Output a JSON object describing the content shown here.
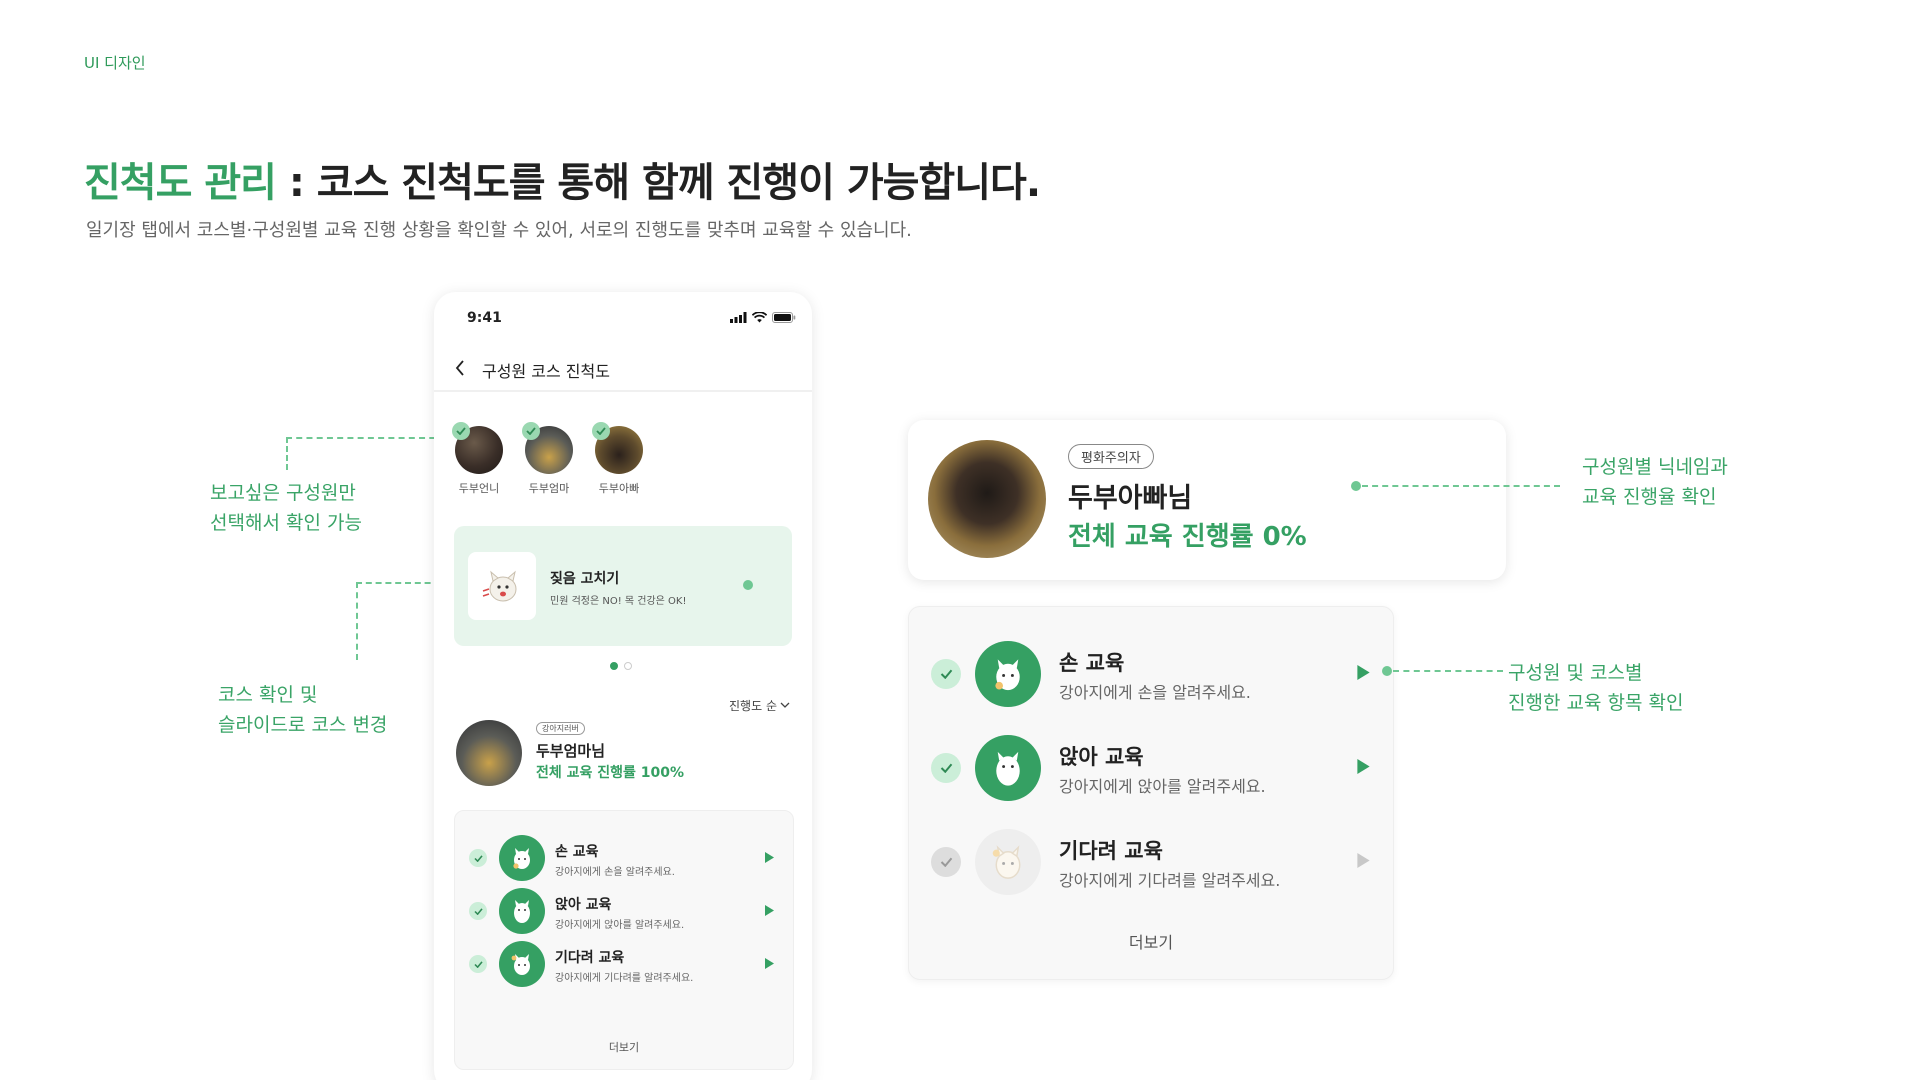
{
  "header": {
    "section_tag": "UI 디자인",
    "title_accent": "진척도 관리",
    "title_rest": " : 코스 진척도를 통해 함께 진행이 가능합니다.",
    "subtitle": "일기장 탭에서 코스별·구성원별 교육 진행 상황을 확인할 수 있어, 서로의 진행도를 맞추며 교육할 수 있습니다."
  },
  "annotations": {
    "member_select": [
      "보고싶은 구성원만",
      "선택해서 확인 가능"
    ],
    "course_slide": [
      "코스 확인 및",
      "슬라이드로 코스 변경"
    ],
    "nickname_progress": [
      "구성원별 닉네임과",
      "교육 진행율 확인"
    ],
    "member_course_items": [
      "구성원 및 코스별",
      "진행한 교육 항목 확인"
    ]
  },
  "phone": {
    "status_time": "9:41",
    "nav_title": "구성원 코스 진척도",
    "members": [
      {
        "name": "두부언니",
        "selected": true
      },
      {
        "name": "두부엄마",
        "selected": true
      },
      {
        "name": "두부아빠",
        "selected": true
      }
    ],
    "course": {
      "title": "짖음 고치기",
      "desc": "민원 걱정은 NO! 목 건강은 OK!",
      "pages": 2,
      "active_page": 1
    },
    "sort_label": "진행도 순",
    "profile": {
      "badge": "강아지러버",
      "name": "두부엄마님",
      "progress": "전체 교육 진행률 100%"
    },
    "edu_items": [
      {
        "title": "손 교육",
        "desc": "강아지에게 손을 알려주세요.",
        "done": true
      },
      {
        "title": "앉아 교육",
        "desc": "강아지에게 앉아를 알려주세요.",
        "done": true
      },
      {
        "title": "기다려 교육",
        "desc": "강아지에게 기다려를 알려주세요.",
        "done": true
      }
    ],
    "more_label": "더보기"
  },
  "detail": {
    "profile": {
      "badge": "평화주의자",
      "name": "두부아빠님",
      "progress": "전체 교육 진행률 0%"
    },
    "edu_items": [
      {
        "title": "손 교육",
        "desc": "강아지에게 손을 알려주세요.",
        "done": true
      },
      {
        "title": "앉아 교육",
        "desc": "강아지에게 앉아를 알려주세요.",
        "done": true
      },
      {
        "title": "기다려 교육",
        "desc": "강아지에게 기다려를 알려주세요.",
        "done": false
      }
    ],
    "more_label": "더보기"
  },
  "colors": {
    "accent": "#35a063",
    "accent_light": "#e7f5ec",
    "annotation": "#3aa467",
    "dash": "#6fc793"
  }
}
